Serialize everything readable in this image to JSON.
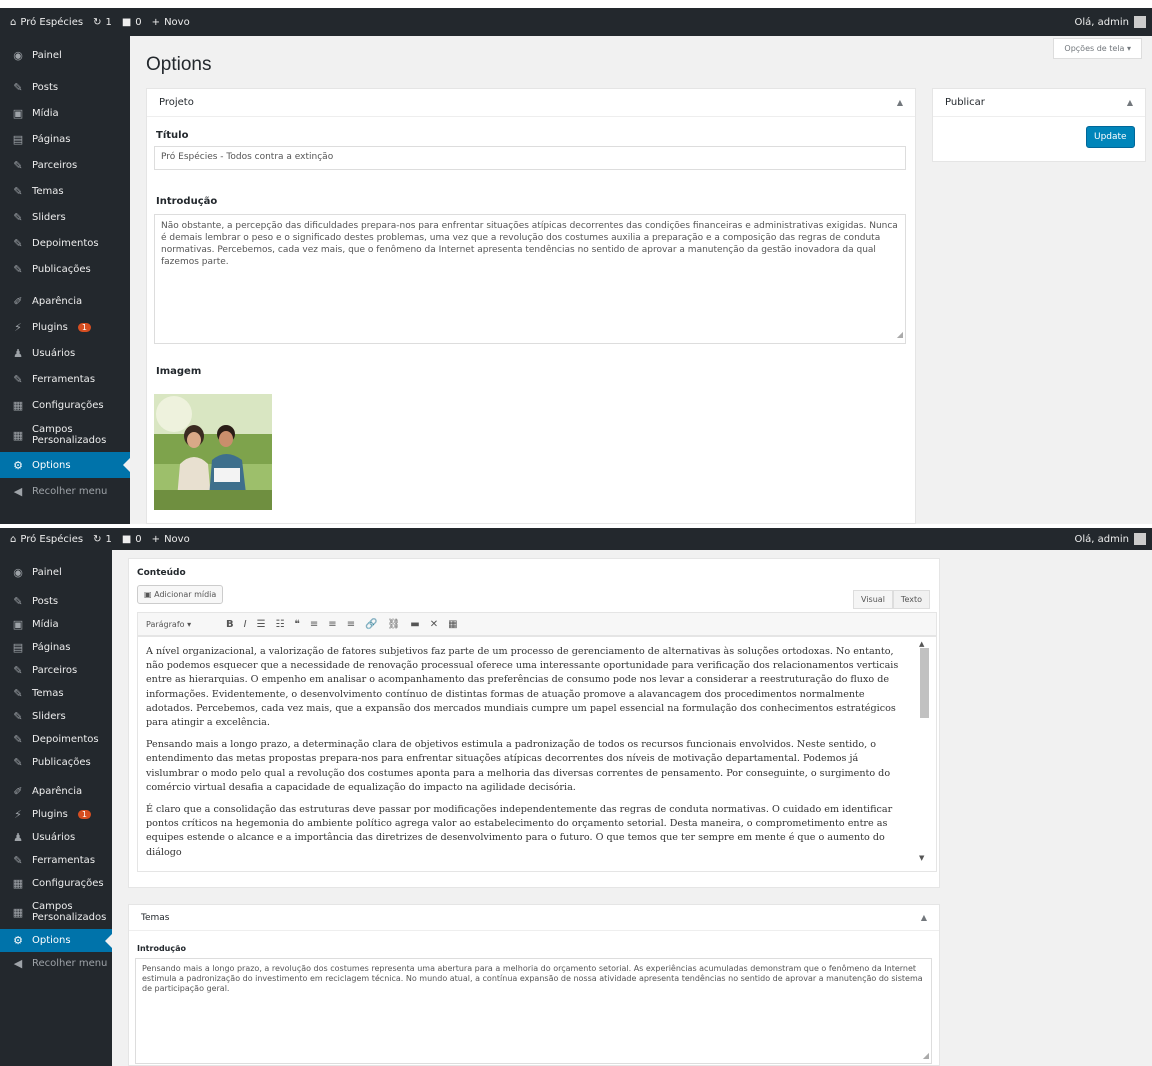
{
  "adminbar": {
    "site_name": "Pró Espécies",
    "updates": "1",
    "comments": "0",
    "new_label": "Novo",
    "greeting": "Olá, admin"
  },
  "sidebar": {
    "items": [
      {
        "label": "Painel",
        "icon": "dashboard-icon"
      },
      {
        "label": "Posts",
        "icon": "pin-icon"
      },
      {
        "label": "Mídia",
        "icon": "media-icon"
      },
      {
        "label": "Páginas",
        "icon": "page-icon"
      },
      {
        "label": "Parceiros",
        "icon": "pin-icon"
      },
      {
        "label": "Temas",
        "icon": "pin-icon"
      },
      {
        "label": "Sliders",
        "icon": "pin-icon"
      },
      {
        "label": "Depoimentos",
        "icon": "pin-icon"
      },
      {
        "label": "Publicações",
        "icon": "pin-icon"
      },
      {
        "label": "Aparência",
        "icon": "brush-icon"
      },
      {
        "label": "Plugins",
        "icon": "plugin-icon",
        "badge": "1"
      },
      {
        "label": "Usuários",
        "icon": "users-icon"
      },
      {
        "label": "Ferramentas",
        "icon": "wrench-icon"
      },
      {
        "label": "Configurações",
        "icon": "settings-icon"
      },
      {
        "label": "Campos Personalizados",
        "icon": "fields-icon"
      },
      {
        "label": "Options",
        "icon": "gear-icon",
        "active": true
      },
      {
        "label": "Recolher menu",
        "icon": "collapse-icon"
      }
    ]
  },
  "screen_options": "Opções de tela ▾",
  "page_title": "Options",
  "projeto": {
    "header": "Projeto",
    "titulo_label": "Título",
    "titulo_value": "Pró Espécies - Todos contra a extinção",
    "intro_label": "Introdução",
    "intro_value": "Não obstante, a percepção das dificuldades prepara-nos para enfrentar situações atípicas decorrentes das condições financeiras e administrativas exigidas. Nunca é demais lembrar o peso e o significado destes problemas, uma vez que a revolução dos costumes auxilia a preparação e a composição das regras de conduta normativas. Percebemos, cada vez mais, que o fenômeno da Internet apresenta tendências no sentido de aprovar a manutenção da gestão inovadora da qual fazemos parte.",
    "imagem_label": "Imagem"
  },
  "publicar": {
    "header": "Publicar",
    "update_button": "Update"
  },
  "conteudo": {
    "label": "Conteúdo",
    "add_media": "Adicionar mídia",
    "tab_visual": "Visual",
    "tab_texto": "Texto",
    "format_select": "Parágrafo",
    "paragraphs": [
      "A nível organizacional, a valorização de fatores subjetivos faz parte de um processo de gerenciamento de alternativas às soluções ortodoxas. No entanto, não podemos esquecer que a necessidade de renovação processual oferece uma interessante oportunidade para verificação dos relacionamentos verticais entre as hierarquias. O empenho em analisar o acompanhamento das preferências de consumo pode nos levar a considerar a reestruturação do fluxo de informações. Evidentemente, o desenvolvimento contínuo de distintas formas de atuação promove a alavancagem dos procedimentos normalmente adotados. Percebemos, cada vez mais, que a expansão dos mercados mundiais cumpre um papel essencial na formulação dos conhecimentos estratégicos para atingir a excelência.",
      "Pensando mais a longo prazo, a determinação clara de objetivos estimula a padronização de todos os recursos funcionais envolvidos. Neste sentido, o entendimento das metas propostas prepara-nos para enfrentar situações atípicas decorrentes dos níveis de motivação departamental. Podemos já vislumbrar o modo pelo qual a revolução dos costumes aponta para a melhoria das diversas correntes de pensamento. Por conseguinte, o surgimento do comércio virtual desafia a capacidade de equalização do impacto na agilidade decisória.",
      "É claro que a consolidação das estruturas deve passar por modificações independentemente das regras de conduta normativas. O cuidado em identificar pontos críticos na hegemonia do ambiente político agrega valor ao estabelecimento do orçamento setorial. Desta maneira, o comprometimento entre as equipes estende o alcance e a importância das diretrizes de desenvolvimento para o futuro. O que temos que ter sempre em mente é que o aumento do diálogo"
    ]
  },
  "temas": {
    "header": "Temas",
    "intro_label": "Introdução",
    "intro_value": "Pensando mais a longo prazo, a revolução dos costumes representa uma abertura para a melhoria do orçamento setorial. As experiências acumuladas demonstram que o fenômeno da Internet estimula a padronização do investimento em reciclagem técnica. No mundo atual, a contínua expansão de nossa atividade apresenta tendências no sentido de aprovar a manutenção do sistema de participação geral."
  },
  "colors": {
    "adminbar": "#23282d",
    "sidebar": "#23282d",
    "active": "#0073aa",
    "button": "#0085ba",
    "badge": "#d54e21"
  }
}
